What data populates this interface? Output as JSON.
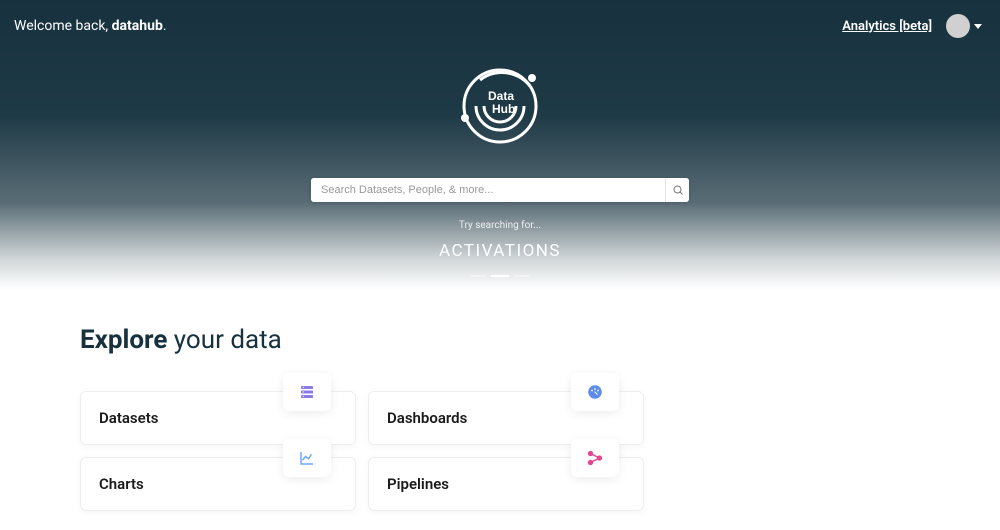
{
  "header": {
    "welcome_prefix": "Welcome back, ",
    "username": "datahub",
    "welcome_suffix": ".",
    "analytics_label": "Analytics [beta]"
  },
  "logo_text": {
    "line1": "Data",
    "line2": "Hub"
  },
  "search": {
    "placeholder": "Search Datasets, People, & more..."
  },
  "suggestion": {
    "try_label": "Try searching for...",
    "term": "ACTIVATIONS"
  },
  "explore": {
    "bold": "Explore",
    "light": " your data"
  },
  "cards": {
    "datasets": "Datasets",
    "dashboards": "Dashboards",
    "charts": "Charts",
    "pipelines": "Pipelines"
  }
}
